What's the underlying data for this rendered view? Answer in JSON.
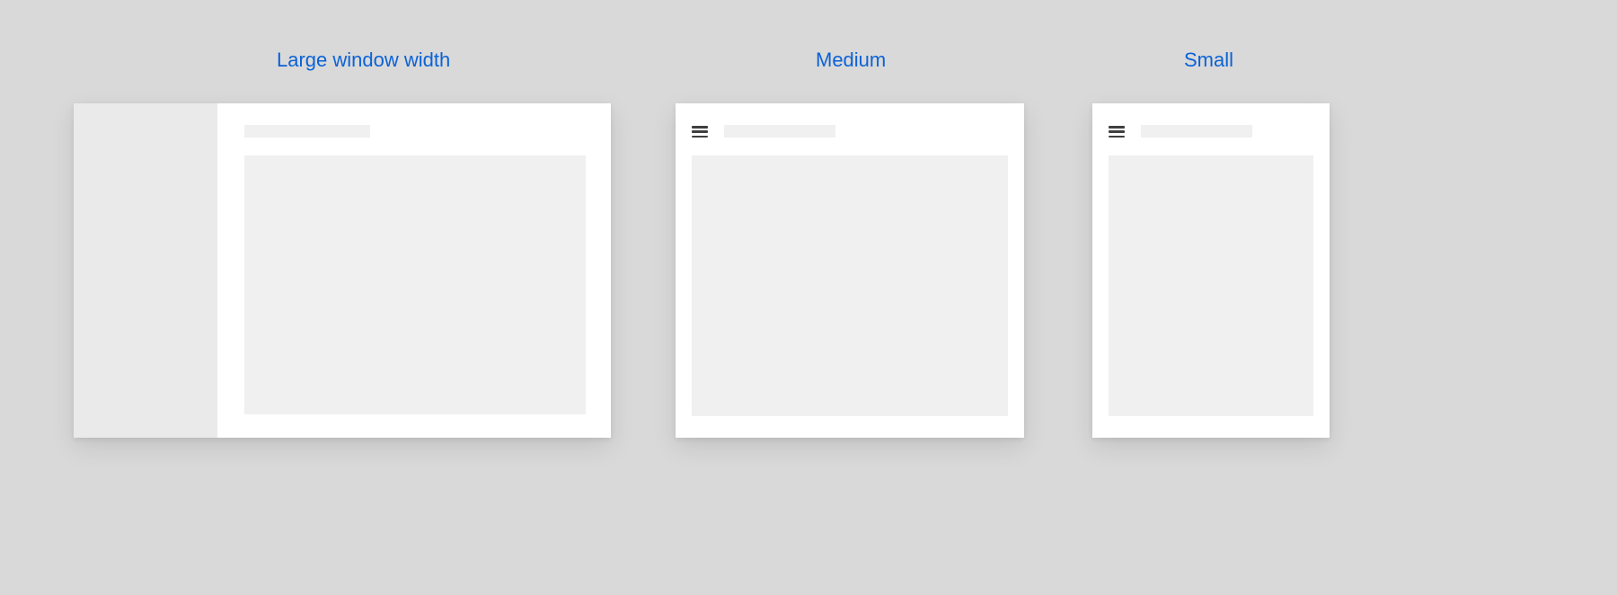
{
  "labels": {
    "large": "Large window width",
    "medium": "Medium",
    "small": "Small"
  },
  "colors": {
    "page_bg": "#d9d9d9",
    "window_bg": "#ffffff",
    "sidebar_bg": "#eaeaea",
    "placeholder_bg": "#f0f0f0",
    "label_color": "#0b62d6",
    "icon_color": "#3f3f3f"
  },
  "icons": {
    "menu": "hamburger-icon"
  },
  "layouts": {
    "large": {
      "has_sidebar": true,
      "has_menu_icon": false
    },
    "medium": {
      "has_sidebar": false,
      "has_menu_icon": true
    },
    "small": {
      "has_sidebar": false,
      "has_menu_icon": true
    }
  }
}
